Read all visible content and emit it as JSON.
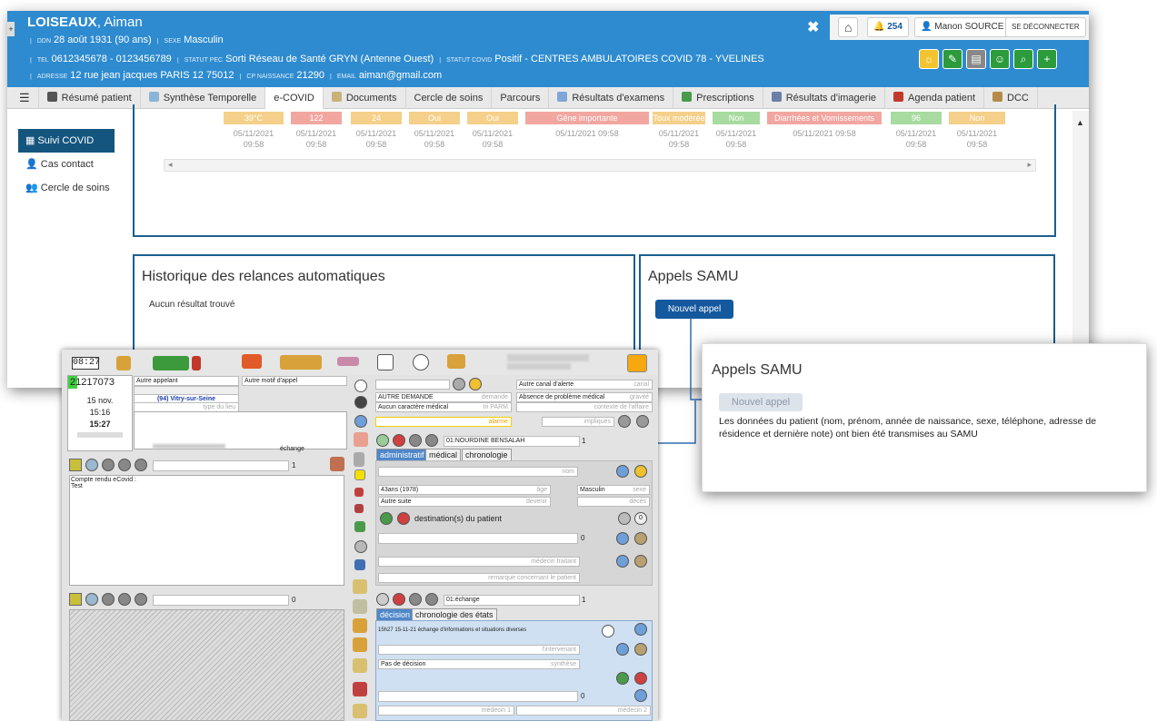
{
  "patient": {
    "lastname": "LOISEAUX",
    "firstname": ", Aiman",
    "ddn_label": "DDN",
    "ddn": "28 août 1931 (90 ans)",
    "sexe_label": "SEXE",
    "sexe": "Masculin",
    "tel_label": "TEL",
    "tel": "0612345678 - 0123456789",
    "pec_label": "STATUT PEC",
    "pec": "Sorti Réseau de Santé GRYN (Antenne Ouest)",
    "covid_label": "STATUT COVID",
    "covid": "Positif - CENTRES AMBULATOIRES COVID 78 - YVELINES",
    "adresse_label": "ADRESSE",
    "adresse": "12 rue jean jacques PARIS 12 75012",
    "cp_label": "CP NAISSANCE",
    "cp": "21290",
    "email_label": "EMAIL",
    "email": "aiman@gmail.com"
  },
  "header": {
    "close": "✖",
    "home": "⌂",
    "notif_count": "254",
    "user": "Manon SOURCE",
    "logout": "SE DÉCONNECTER"
  },
  "nav": {
    "menu": "☰",
    "tabs": [
      "Résumé patient",
      "Synthèse Temporelle",
      "e-COVID",
      "Documents",
      "Cercle de soins",
      "Parcours",
      "Résultats d'examens",
      "Prescriptions",
      "Résultats d'imagerie",
      "Agenda patient",
      "DCC"
    ]
  },
  "sidebar": {
    "items": [
      "Suivi COVID",
      "Cas contact",
      "Cercle de soins"
    ]
  },
  "covid_table": {
    "values": [
      "39°C",
      "122",
      "24",
      "Oui",
      "Oui",
      "Gêne importante",
      "Toux modérée",
      "Non",
      "Diarrhées et Vomissements",
      "96",
      "Non"
    ],
    "colors": [
      "#f5d08a",
      "#f2a6a0",
      "#f5d08a",
      "#f5d08a",
      "#f5d08a",
      "#f2a6a0",
      "#f5d08a",
      "#a8dba0",
      "#f2a6a0",
      "#a8dba0",
      "#f5d08a"
    ],
    "dates": [
      "05/11/2021\n09:58",
      "05/11/2021\n09:58",
      "05/11/2021\n09:58",
      "05/11/2021\n09:58",
      "05/11/2021\n09:58",
      "05/11/2021 09:58",
      "05/11/2021\n09:58",
      "05/11/2021\n09:58",
      "05/11/2021 09:58",
      "05/11/2021\n09:58",
      "05/11/2021\n09:58"
    ]
  },
  "historique": {
    "title": "Historique des relances automatiques",
    "empty": "Aucun résultat trouvé"
  },
  "samu": {
    "title": "Appels SAMU",
    "button": "Nouvel appel"
  },
  "popup": {
    "title": "Appels SAMU",
    "button": "Nouvel appel",
    "message": "Les données du patient (nom, prénom, année de naissance, sexe, téléphone, adresse de résidence et dernière note) ont bien été transmises au SAMU"
  },
  "legacy": {
    "time_display": "08:27",
    "call_id": "21217073",
    "date": "15 nov.",
    "time1": "15:16",
    "time2": "15:27",
    "autre_appelant": "Autre appelant",
    "autre_motif": "Autre motif d'appel",
    "location": "(94) Vitry-sur-Seine",
    "type_lieu": "type du lieu",
    "echange": "échange",
    "page1": "1",
    "compte_rendu": "Compte rendu eCovid :\nTest",
    "page0": "0",
    "autre_canal": "Autre canal d'alerte",
    "canal": "canal",
    "autre_demande": "AUTRE DEMANDE",
    "demande": "demande",
    "absence": "Absence de problème médical",
    "gravite": "gravité",
    "aucun_caractere": "Aucun caractère médical",
    "parm": "tri PARM",
    "contexte": "contexte de l'affaire",
    "alarme": "alarme",
    "impliques": "impliqués",
    "nourdine": "01:NOURDINE BENSALAH",
    "tab_admin": "administratif",
    "tab_medical": "médical",
    "tab_chrono": "chronologie",
    "nom": "nom",
    "age": "43ans (1978)",
    "age_ph": "âge",
    "sexe_val": "Masculin",
    "sexe_ph": "sexe",
    "autre_suite": "Autre suite",
    "devenir": "devenir",
    "deces": "décès",
    "destination": "destination(s) du patient",
    "dest_count": "0",
    "medecin_traitant": "médecin traitant",
    "remarque": "remarque concernant le patient",
    "echange_sel": "01:échange",
    "tab_decision": "décision",
    "tab_chrono_etats": "chronologie des états",
    "decision_text": "15h27 15-11-21 échange d'informations et situations diverses",
    "intervenant": "l'intervenant",
    "pas_decision": "Pas de décision",
    "synthese": "synthèse",
    "medecin1": "médecin 1",
    "medecin2": "médecin 2"
  }
}
